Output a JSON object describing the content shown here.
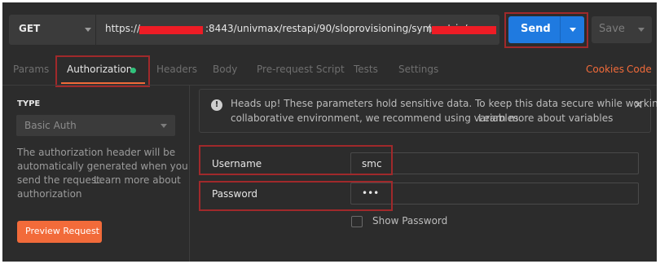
{
  "request": {
    "method": "GET",
    "url_prefix": "https://",
    "url_middle": ":8443/univmax/restapi/90/sloprovisioning/symmetrix/",
    "url_suffix": "("
  },
  "buttons": {
    "send": "Send",
    "save": "Save",
    "preview": "Preview Request"
  },
  "tabs": [
    "Params",
    "Authorization",
    "Headers",
    "Body",
    "Pre-request Script",
    "Tests",
    "Settings"
  ],
  "links": {
    "cookies": "Cookies",
    "code": "Code"
  },
  "auth": {
    "type_label": "TYPE",
    "type_value": "Basic Auth",
    "desc_line1": "The authorization header will be",
    "desc_line2": "automatically generated when you",
    "desc_line3": "send the request.",
    "learn_more_1": "Learn more about",
    "learn_more_2": "authorization"
  },
  "notice": {
    "line1": "Heads up! These parameters hold sensitive data. To keep this data secure while working in a",
    "line2": "collaborative environment, we recommend using variables.",
    "link": "Learn more about variables",
    "close": "×",
    "icon": "!"
  },
  "fields": {
    "username_label": "Username",
    "username_value": "smc",
    "password_label": "Password",
    "password_value": "•••",
    "show_password": "Show Password"
  },
  "colors": {
    "accent": "#f26b3a",
    "send": "#1f7ae0",
    "status_dot": "#2fc27b",
    "redaction": "#ee1c25",
    "highlight": "#a0292b"
  }
}
